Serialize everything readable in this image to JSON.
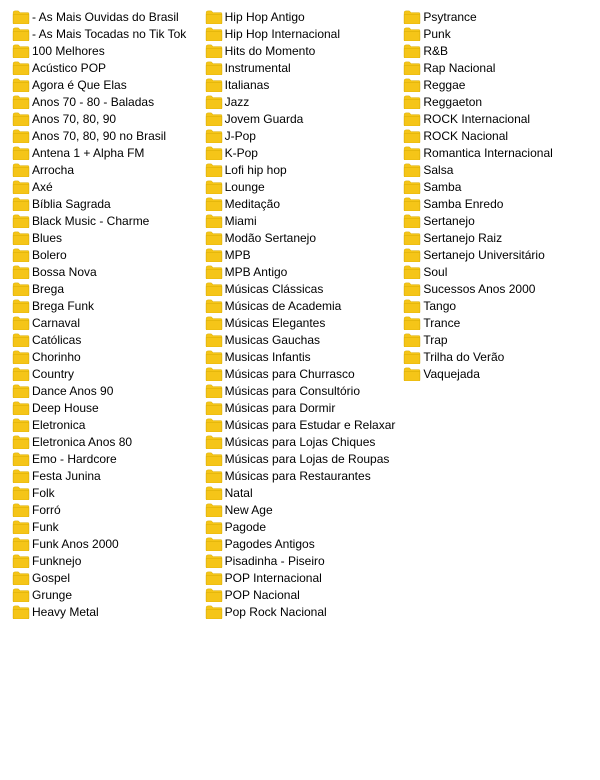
{
  "columns": [
    {
      "id": "col1",
      "items": [
        "- As Mais Ouvidas do Brasil",
        "- As Mais Tocadas no Tik Tok",
        "100 Melhores",
        "Acústico POP",
        "Agora é Que Elas",
        "Anos 70 - 80 - Baladas",
        "Anos 70, 80, 90",
        "Anos 70, 80, 90 no Brasil",
        "Antena 1 + Alpha FM",
        "Arrocha",
        "Axé",
        "Bíblia Sagrada",
        "Black Music - Charme",
        "Blues",
        "Bolero",
        "Bossa Nova",
        "Brega",
        "Brega Funk",
        "Carnaval",
        "Católicas",
        "Chorinho",
        "Country",
        "Dance Anos 90",
        "Deep House",
        "Eletronica",
        "Eletronica Anos 80",
        "Emo - Hardcore",
        "Festa Junina",
        "Folk",
        "Forró",
        "Funk",
        "Funk Anos 2000",
        "Funknejo",
        "Gospel",
        "Grunge",
        "Heavy Metal"
      ]
    },
    {
      "id": "col2",
      "items": [
        "Hip Hop Antigo",
        "Hip Hop Internacional",
        "Hits do Momento",
        "Instrumental",
        "Italianas",
        "Jazz",
        "Jovem Guarda",
        "J-Pop",
        "K-Pop",
        "Lofi hip hop",
        "Lounge",
        "Meditação",
        "Miami",
        "Modão Sertanejo",
        "MPB",
        "MPB Antigo",
        "Músicas Clássicas",
        "Músicas de Academia",
        "Músicas Elegantes",
        "Musicas Gauchas",
        "Musicas Infantis",
        "Músicas para Churrasco",
        "Músicas para Consultório",
        "Músicas para Dormir",
        "Músicas para Estudar e Relaxar",
        "Músicas para Lojas Chiques",
        "Músicas para Lojas de Roupas",
        "Músicas para Restaurantes",
        "Natal",
        "New Age",
        "Pagode",
        "Pagodes Antigos",
        "Pisadinha - Piseiro",
        "POP Internacional",
        "POP Nacional",
        "Pop Rock Nacional"
      ]
    },
    {
      "id": "col3",
      "items": [
        "Psytrance",
        "Punk",
        "R&B",
        "Rap Nacional",
        "Reggae",
        "Reggaeton",
        "ROCK Internacional",
        "ROCK Nacional",
        "Romantica Internacional",
        "Salsa",
        "Samba",
        "Samba Enredo",
        "Sertanejo",
        "Sertanejo Raiz",
        "Sertanejo Universitário",
        "Soul",
        "Sucessos Anos 2000",
        "Tango",
        "Trance",
        "Trap",
        "Trilha do Verão",
        "Vaquejada"
      ]
    }
  ],
  "folder_icon_color": "#f5c518"
}
